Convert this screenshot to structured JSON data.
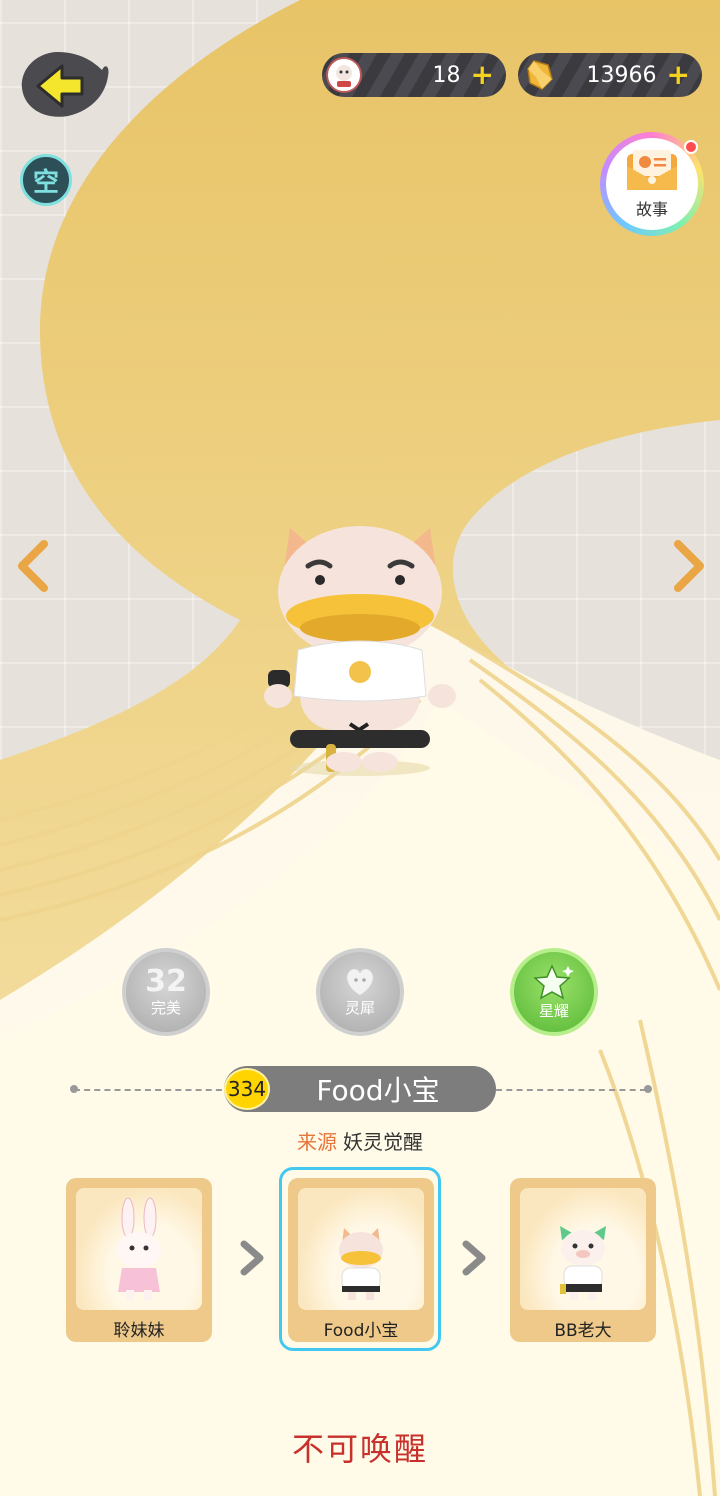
{
  "topbar": {
    "back_icon": "back-arrow-icon",
    "empty_badge_label": "空",
    "ticket": {
      "icon": "pet-ticket-icon",
      "value": "18",
      "plus": "+"
    },
    "crystal": {
      "icon": "crystal-icon",
      "value": "13966",
      "plus": "+"
    },
    "story": {
      "icon": "envelope-icon",
      "label": "故事",
      "has_notification": true
    }
  },
  "nav": {
    "prev_icon": "chevron-left-icon",
    "next_icon": "chevron-right-icon"
  },
  "skills": [
    {
      "value": "32",
      "label": "完美",
      "state": "disabled",
      "icon": "number-badge"
    },
    {
      "label": "灵犀",
      "state": "disabled",
      "icon": "heart-face-icon"
    },
    {
      "label": "星耀",
      "state": "active",
      "icon": "star-icon"
    }
  ],
  "pet": {
    "level": "334",
    "name": "Food小宝",
    "source_label": "来源",
    "source_value": "妖灵觉醒"
  },
  "evolution": [
    {
      "label": "聆妹妹",
      "icon": "bunny-pet-icon"
    },
    {
      "label": "Food小宝",
      "icon": "duck-pet-icon",
      "selected": true
    },
    {
      "label": "BB老大",
      "icon": "pig-pet-icon"
    }
  ],
  "status_text": "不可唤醒",
  "colors": {
    "accent_gold": "#eec989",
    "selected_border": "#44c8f0",
    "status_red": "#c8302c",
    "source_orange": "#e8753a",
    "star_green": "#56b634"
  }
}
